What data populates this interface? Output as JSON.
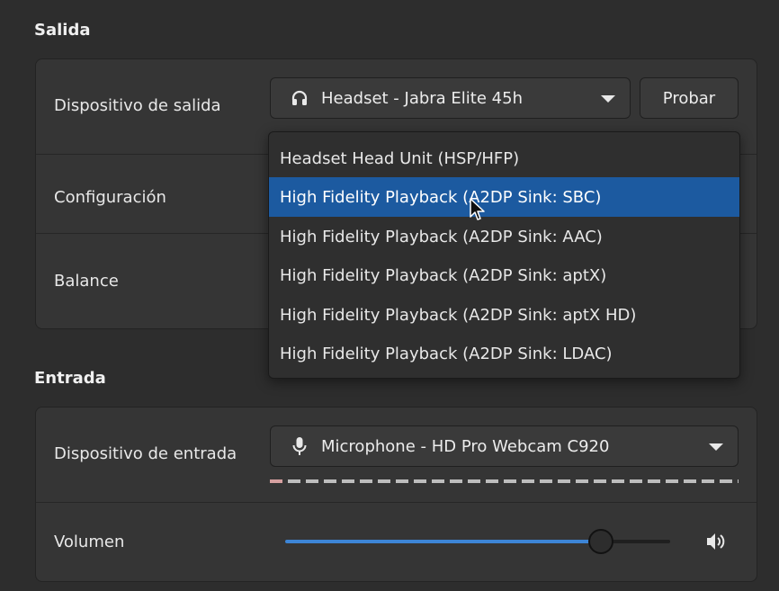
{
  "output": {
    "section_title": "Salida",
    "device_label": "Dispositivo de salida",
    "device_value": "Headset - Jabra Elite 45h",
    "test_button": "Probar",
    "config_label": "Configuración",
    "balance_label": "Balance"
  },
  "profile_dropdown": {
    "items": [
      "Headset Head Unit (HSP/HFP)",
      "High Fidelity Playback (A2DP Sink: SBC)",
      "High Fidelity Playback (A2DP Sink: AAC)",
      "High Fidelity Playback (A2DP Sink: aptX)",
      "High Fidelity Playback (A2DP Sink: aptX HD)",
      "High Fidelity Playback (A2DP Sink: LDAC)"
    ],
    "selected_index": 1
  },
  "input": {
    "section_title": "Entrada",
    "device_label": "Dispositivo de entrada",
    "device_value": "Microphone - HD Pro Webcam C920",
    "volume_label": "Volumen",
    "volume_level": 0.82
  },
  "colors": {
    "accent": "#3d85d6",
    "selection": "#1c5aa0",
    "background": "#2d2d2d"
  },
  "icons": {
    "output_device": "headphones-icon",
    "input_device": "microphone-icon",
    "volume": "speaker-volume-icon"
  }
}
